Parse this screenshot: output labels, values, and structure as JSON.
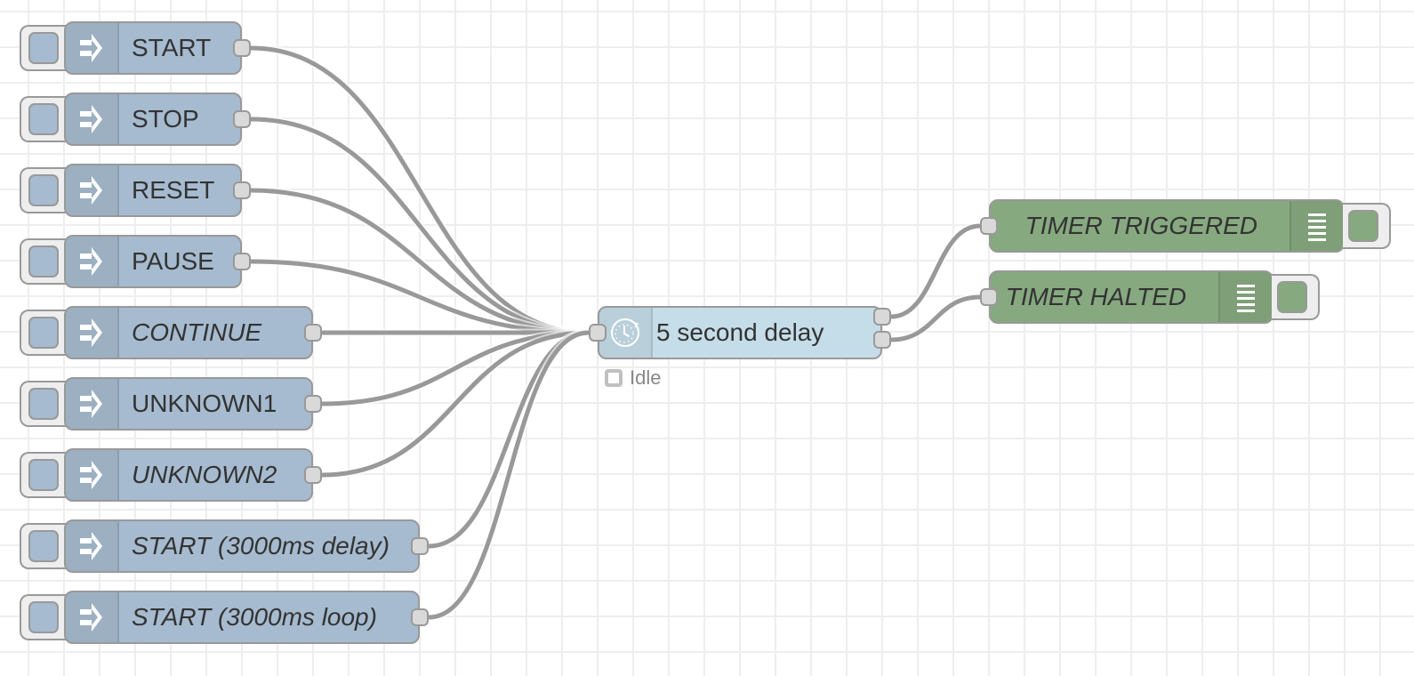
{
  "canvas": {
    "wire_color": "#999999",
    "grid_color": "#eeeeee"
  },
  "inject_nodes": [
    {
      "label": "START",
      "italic": false,
      "icon": "inject-arrow-icon",
      "color": "#a6bbcf"
    },
    {
      "label": "STOP",
      "italic": false,
      "icon": "inject-arrow-icon",
      "color": "#a6bbcf"
    },
    {
      "label": "RESET",
      "italic": false,
      "icon": "inject-arrow-icon",
      "color": "#a6bbcf"
    },
    {
      "label": "PAUSE",
      "italic": false,
      "icon": "inject-arrow-icon",
      "color": "#a6bbcf"
    },
    {
      "label": "CONTINUE",
      "italic": true,
      "icon": "inject-arrow-icon",
      "color": "#a6bbcf"
    },
    {
      "label": "UNKNOWN1",
      "italic": false,
      "icon": "inject-arrow-icon",
      "color": "#a6bbcf"
    },
    {
      "label": "UNKNOWN2",
      "italic": true,
      "icon": "inject-arrow-icon",
      "color": "#a6bbcf"
    },
    {
      "label": "START (3000ms delay)",
      "italic": true,
      "icon": "inject-arrow-icon",
      "color": "#a6bbcf"
    },
    {
      "label": "START (3000ms loop)",
      "italic": true,
      "icon": "inject-arrow-icon",
      "color": "#a6bbcf"
    }
  ],
  "delay_node": {
    "label": "5 second delay",
    "icon": "timer-clock-icon",
    "color": "#c5dde9",
    "outputs": 2,
    "status": {
      "text": "Idle",
      "shape": "ring",
      "color": "grey"
    }
  },
  "debug_nodes": [
    {
      "label": "TIMER TRIGGERED",
      "italic": true,
      "icon": "debug-list-icon",
      "color": "#87a980"
    },
    {
      "label": "TIMER HALTED",
      "italic": true,
      "icon": "debug-list-icon",
      "color": "#87a980"
    }
  ],
  "wires": [
    {
      "from": "inject-0",
      "to": "delay-in"
    },
    {
      "from": "inject-1",
      "to": "delay-in"
    },
    {
      "from": "inject-2",
      "to": "delay-in"
    },
    {
      "from": "inject-3",
      "to": "delay-in"
    },
    {
      "from": "inject-4",
      "to": "delay-in"
    },
    {
      "from": "inject-5",
      "to": "delay-in"
    },
    {
      "from": "inject-6",
      "to": "delay-in"
    },
    {
      "from": "inject-7",
      "to": "delay-in"
    },
    {
      "from": "inject-8",
      "to": "delay-in"
    },
    {
      "from": "delay-out-0",
      "to": "debug-0"
    },
    {
      "from": "delay-out-1",
      "to": "debug-1"
    }
  ]
}
